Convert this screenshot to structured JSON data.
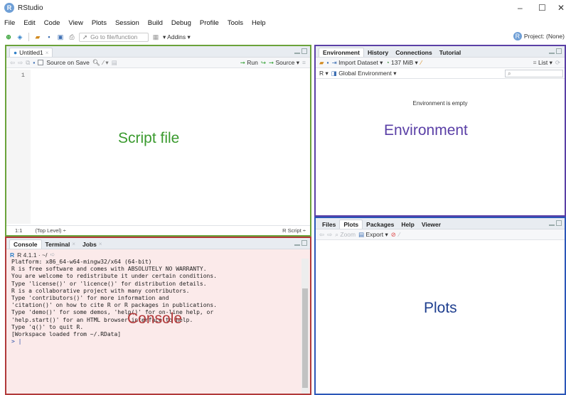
{
  "window": {
    "title": "RStudio",
    "controls": [
      "–",
      "☐",
      "✕"
    ]
  },
  "menu": [
    "File",
    "Edit",
    "Code",
    "View",
    "Plots",
    "Session",
    "Build",
    "Debug",
    "Profile",
    "Tools",
    "Help"
  ],
  "toolbar": {
    "goto_placeholder": "Go to file/function",
    "addins_label": "Addins",
    "project_label": "Project: (None)"
  },
  "script_pane": {
    "tab_label": "Untitled1",
    "source_on_save": "Source on Save",
    "run_label": "Run",
    "source_label": "Source",
    "line_number": "1",
    "big_label": "Script file",
    "status_position": "1:1",
    "status_scope": "(Top Level) ÷",
    "status_lang": "R Script ÷"
  },
  "env_pane": {
    "tabs": [
      "Environment",
      "History",
      "Connections",
      "Tutorial"
    ],
    "import_label": "Import Dataset",
    "memory_label": "137 MiB",
    "list_label": "List",
    "r_label": "R",
    "global_env_label": "Global Environment",
    "empty_message": "Environment is empty",
    "big_label": "Environment"
  },
  "plots_pane": {
    "tabs": [
      "Files",
      "Plots",
      "Packages",
      "Help",
      "Viewer"
    ],
    "zoom_label": "Zoom",
    "export_label": "Export",
    "big_label": "Plots"
  },
  "console_pane": {
    "tabs": [
      "Console",
      "Terminal",
      "Jobs"
    ],
    "r_version": "R 4.1.1 · ~/",
    "lines": [
      "Platform: x86_64-w64-mingw32/x64 (64-bit)",
      "",
      "R is free software and comes with ABSOLUTELY NO WARRANTY.",
      "You are welcome to redistribute it under certain conditions.",
      "Type 'license()' or 'licence()' for distribution details.",
      "",
      "R is a collaborative project with many contributors.",
      "Type 'contributors()' for more information and",
      "'citation()' on how to cite R or R packages in publications.",
      "",
      "Type 'demo()' for some demos, 'help()' for on-line help, or",
      "'help.start()' for an HTML browser interface to help.",
      "Type 'q()' to quit R.",
      "",
      "[Workspace loaded from ~/.RData]",
      ""
    ],
    "prompt": ">",
    "big_label": "Console"
  }
}
